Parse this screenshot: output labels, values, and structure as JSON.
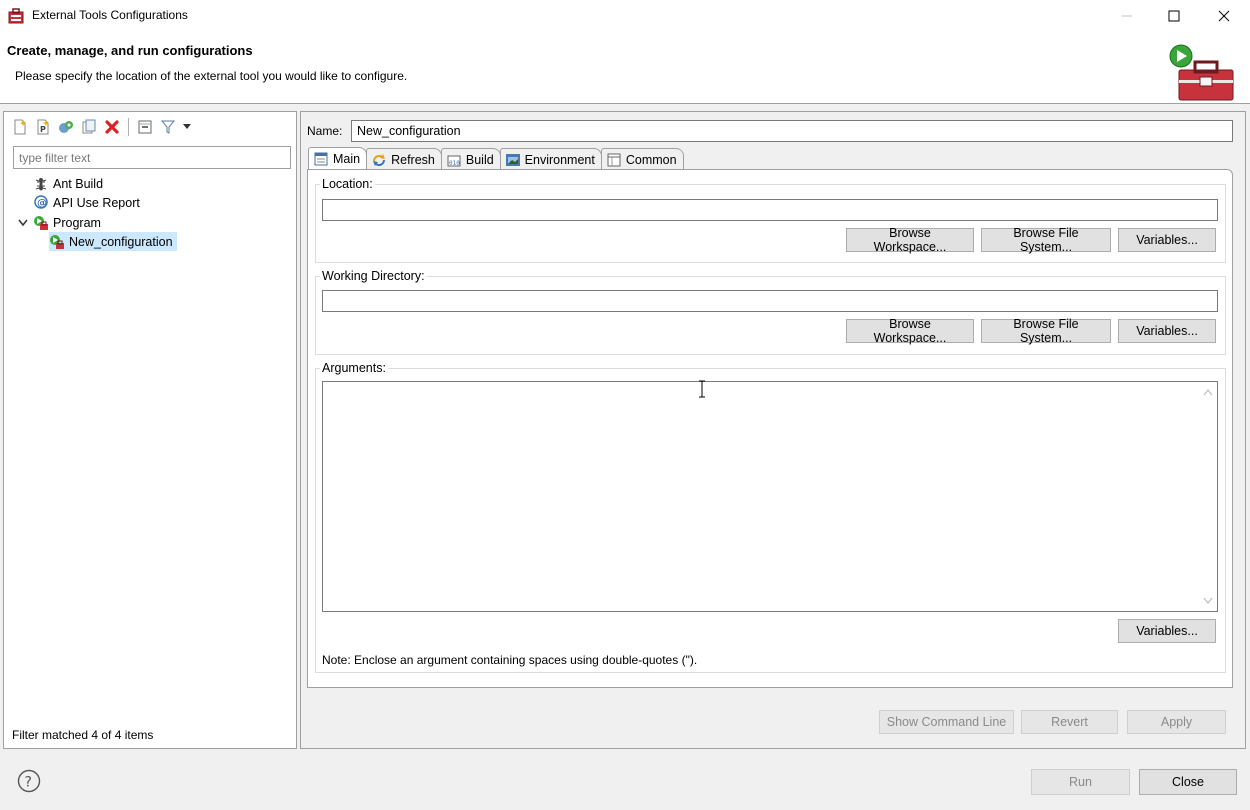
{
  "window": {
    "title": "External Tools Configurations",
    "minimize_glyph": "—",
    "maximize_glyph": "☐",
    "close_glyph": "✕"
  },
  "header": {
    "title": "Create, manage, and run configurations",
    "description": "Please specify the location of the external tool you would like to configure."
  },
  "left": {
    "filter_placeholder": "type filter text",
    "filter_value": "",
    "tree": [
      {
        "label": "Ant Build",
        "icon": "ant-icon"
      },
      {
        "label": "API Use Report",
        "icon": "api-report-icon"
      },
      {
        "label": "Program",
        "icon": "program-icon",
        "expanded": true
      },
      {
        "label": "New_configuration",
        "icon": "program-config-icon",
        "selected": true
      }
    ],
    "status": "Filter matched 4 of 4 items",
    "expand_glyph": "v"
  },
  "right": {
    "name_label": "Name:",
    "name_value": "New_configuration",
    "tabs": [
      {
        "label": "Main",
        "icon": "main-tab-icon",
        "active": true
      },
      {
        "label": "Refresh",
        "icon": "refresh-icon"
      },
      {
        "label": "Build",
        "icon": "build-icon"
      },
      {
        "label": "Environment",
        "icon": "environment-icon"
      },
      {
        "label": "Common",
        "icon": "common-icon"
      }
    ],
    "location": {
      "label": "Location:",
      "value": "",
      "browse_workspace": "Browse Workspace...",
      "browse_filesystem": "Browse File System...",
      "variables": "Variables..."
    },
    "working_directory": {
      "label": "Working Directory:",
      "value": "",
      "browse_workspace": "Browse Workspace...",
      "browse_filesystem": "Browse File System...",
      "variables": "Variables..."
    },
    "arguments": {
      "label": "Arguments:",
      "value": "",
      "variables": "Variables...",
      "note": "Note: Enclose an argument containing spaces using double-quotes (\")."
    },
    "show_command_line": "Show Command Line",
    "revert": "Revert",
    "apply": "Apply"
  },
  "footer": {
    "help_glyph": "?",
    "run": "Run",
    "close": "Close"
  },
  "colors": {
    "selection": "#cce8ff",
    "border": "#a0a0a0",
    "panel_bg": "#f0f0f0",
    "toolbox_red": "#c8323c"
  }
}
